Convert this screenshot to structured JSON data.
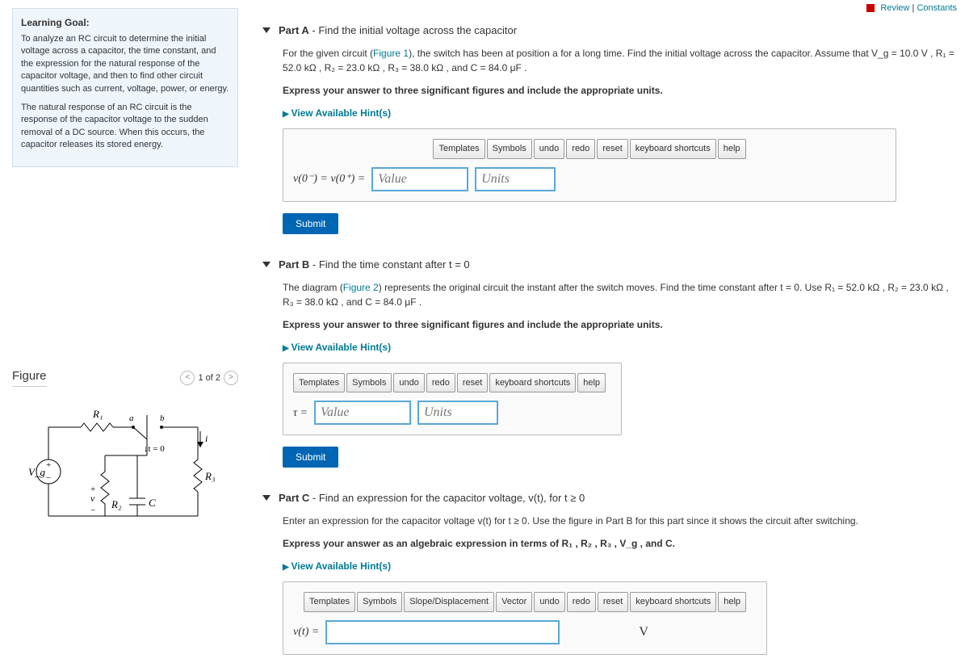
{
  "topLinks": {
    "review": "Review",
    "constants": "Constants"
  },
  "learningGoal": {
    "heading": "Learning Goal:",
    "p1": "To analyze an RC circuit to determine the initial voltage across a capacitor, the time constant, and the expression for the natural response of the capacitor voltage, and then to find other circuit quantities such as current, voltage, power, or energy.",
    "p2": "The natural response of an RC circuit is the response of the capacitor voltage to the sudden removal of a DC source. When this occurs, the capacitor releases its stored energy."
  },
  "figure": {
    "title": "Figure",
    "counter": "1 of 2",
    "labels": {
      "R1": "R₁",
      "R2": "R₂",
      "R3": "R₃",
      "Vg": "V_g",
      "C": "C",
      "a": "a",
      "b": "b",
      "v": "v",
      "i": "i",
      "t0": "t = 0",
      "plus": "+",
      "minus": "−"
    }
  },
  "partA": {
    "title_bold": "Part A",
    "title_rest": " - Find the initial voltage across the capacitor",
    "prompt_pre": "For the given circuit (",
    "figref": "Figure 1",
    "prompt_post": "), the switch has been at position a for a long time. Find the initial voltage across the capacitor. Assume that V_g = 10.0 V , R₁ = 52.0 kΩ , R₂ = 23.0 kΩ , R₃ = 38.0 kΩ , and C = 84.0 μF .",
    "express": "Express your answer to three significant figures and include the appropriate units.",
    "hints": "View Available Hint(s)",
    "eq": "v(0⁻) = v(0⁺) =",
    "value_ph": "Value",
    "units_ph": "Units",
    "submit": "Submit"
  },
  "partB": {
    "title_bold": "Part B",
    "title_rest": " - Find the time constant after t = 0",
    "prompt_pre": "The diagram (",
    "figref": "Figure 2",
    "prompt_post": ") represents the original circuit the instant after the switch moves. Find the time constant after t = 0. Use R₁ = 52.0 kΩ , R₂ = 23.0 kΩ , R₃ = 38.0 kΩ , and C = 84.0 μF .",
    "express": "Express your answer to three significant figures and include the appropriate units.",
    "hints": "View Available Hint(s)",
    "eq": "τ =",
    "value_ph": "Value",
    "units_ph": "Units",
    "submit": "Submit"
  },
  "partC": {
    "title_bold": "Part C",
    "title_rest": " - Find an expression for the capacitor voltage, v(t), for t ≥ 0",
    "prompt": "Enter an expression for the capacitor voltage v(t) for t ≥ 0. Use the figure in Part B for this part since it shows the circuit after switching.",
    "express": "Express your answer as an algebraic expression in terms of R₁ , R₂ , R₃ , V_g , and C.",
    "hints": "View Available Hint(s)",
    "eq": "v(t) =",
    "unit": "V"
  },
  "toolbar": {
    "templates": "Templates",
    "symbols": "Symbols",
    "slope": "Slope/Displacement",
    "vector": "Vector",
    "undo": "undo",
    "redo": "redo",
    "reset": "reset",
    "kbd": "keyboard shortcuts",
    "help": "help"
  }
}
